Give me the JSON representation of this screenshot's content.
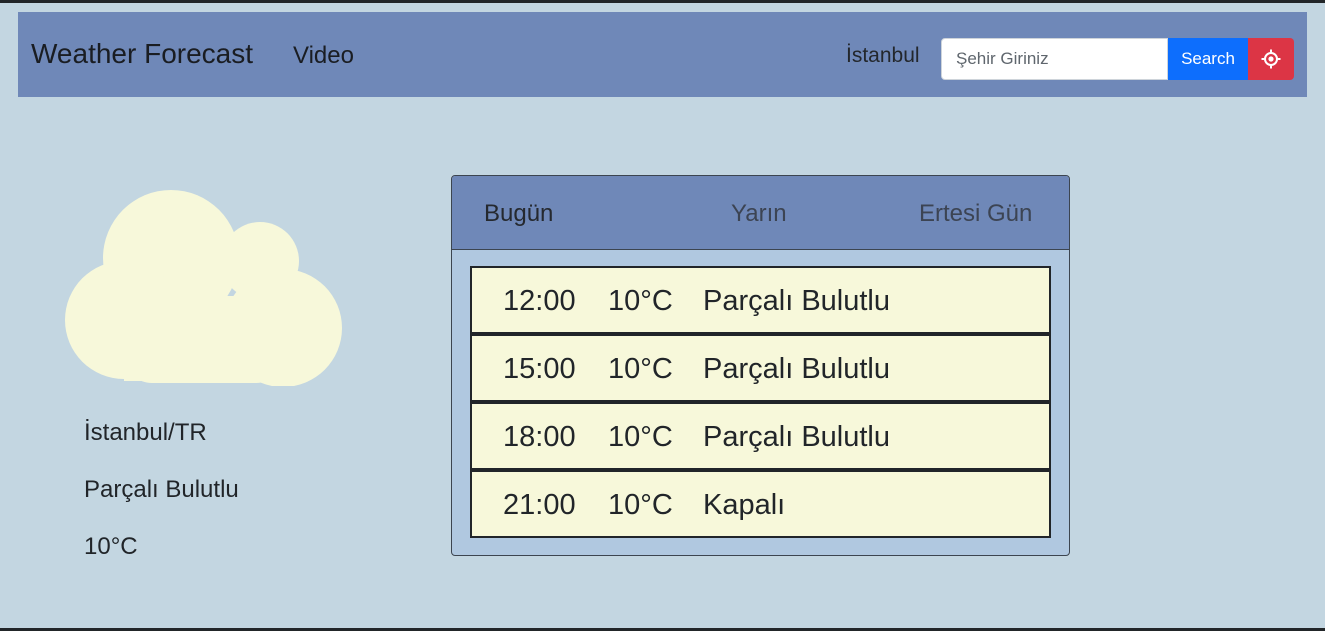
{
  "navbar": {
    "brand": "Weather Forecast",
    "video_link": "Video",
    "current_city": "İstanbul",
    "search_placeholder": "Şehir Giriniz",
    "search_value": "",
    "search_button": "Search",
    "locate_icon": "crosshair-icon"
  },
  "current": {
    "icon": "cloud-icon",
    "location": "İstanbul/TR",
    "description": "Parçalı Bulutlu",
    "temperature": "10°C"
  },
  "forecast": {
    "tabs": [
      {
        "label": "Bugün",
        "active": true
      },
      {
        "label": "Yarın",
        "active": false
      },
      {
        "label": "Ertesi Gün",
        "active": false
      }
    ],
    "rows": [
      {
        "time": "12:00",
        "temp": "10°C",
        "desc": "Parçalı Bulutlu"
      },
      {
        "time": "15:00",
        "temp": "10°C",
        "desc": "Parçalı Bulutlu"
      },
      {
        "time": "18:00",
        "temp": "10°C",
        "desc": "Parçalı Bulutlu"
      },
      {
        "time": "21:00",
        "temp": "10°C",
        "desc": "Kapalı"
      }
    ]
  },
  "colors": {
    "background": "#c3d6e1",
    "navbar": "#6f88b8",
    "search_button": "#0d6efd",
    "locate_button": "#dc3545",
    "cloud": "#f7f8da",
    "row_background": "#f7f8da"
  }
}
